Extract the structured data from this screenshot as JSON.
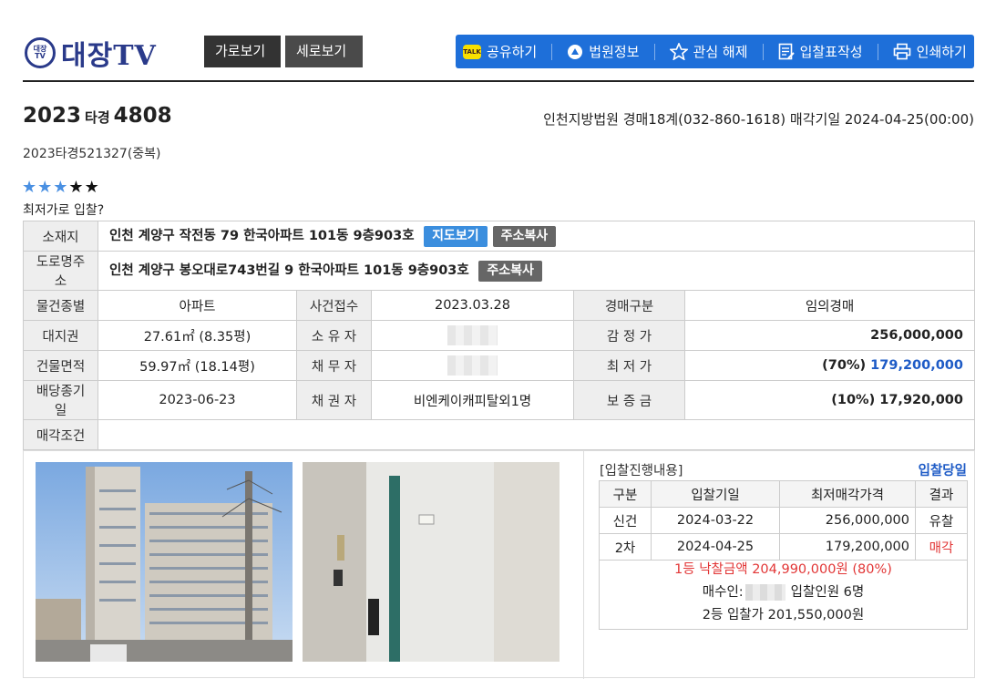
{
  "header": {
    "logo_mark": "대장 TV",
    "logo_text": "대장TV",
    "view_horizontal": "가로보기",
    "view_vertical": "세로보기",
    "tools": [
      {
        "label": "공유하기",
        "icon": "kakaotalk-icon"
      },
      {
        "label": "법원정보",
        "icon": "court-icon"
      },
      {
        "label": "관심 해제",
        "icon": "star-outline-icon"
      },
      {
        "label": "입찰표작성",
        "icon": "form-icon"
      },
      {
        "label": "인쇄하기",
        "icon": "printer-icon"
      }
    ],
    "talk_icon_text": "TALK"
  },
  "case": {
    "year": "2023",
    "type": "타경",
    "number": "4808",
    "court_info": "인천지방법원 경매18계(032-860-1618) 매각기일 2024-04-25(00:00)",
    "sub_case": "2023타경521327(중복)",
    "rating": 3,
    "rating_max": 5,
    "question": "최저가로 입찰?"
  },
  "info": {
    "location_label": "소재지",
    "location": "인천 계양구 작전동 79 한국아파트 101동 9층903호",
    "map_button": "지도보기",
    "copy_button": "주소복사",
    "road_label": "도로명주소",
    "road": "인천 계양구 봉오대로743번길 9 한국아파트 101동 9층903호",
    "rows": [
      {
        "l1": "물건종별",
        "v1": "아파트",
        "l2": "사건접수",
        "v2": "2023.03.28",
        "l3": "경매구분",
        "v3": "임의경매"
      },
      {
        "l1": "대지권",
        "v1": "27.61㎡ (8.35평)",
        "l2": "소 유 자",
        "v2": "",
        "l3": "감 정 가",
        "v3": "256,000,000"
      },
      {
        "l1": "건물면적",
        "v1": "59.97㎡ (18.14평)",
        "l2": "채 무 자",
        "v2": "",
        "l3": "최 저 가",
        "v3_pct": "(70%)",
        "v3": "179,200,000"
      },
      {
        "l1": "배당종기일",
        "v1": "2023-06-23",
        "l2": "채 권 자",
        "v2": "비엔케이캐피탈외1명",
        "l3": "보 증 금",
        "v3": "(10%) 17,920,000"
      }
    ],
    "condition_label": "매각조건",
    "condition": ""
  },
  "bids": {
    "title": "[입찰진행내용]",
    "today": "입찰당일",
    "headers": [
      "구분",
      "입찰기일",
      "최저매각가격",
      "결과"
    ],
    "rows": [
      {
        "round": "신건",
        "date": "2024-03-22",
        "price": "256,000,000",
        "result": "유찰"
      },
      {
        "round": "2차",
        "date": "2024-04-25",
        "price": "179,200,000",
        "result": "매각"
      }
    ],
    "winning": "1등 낙찰금액 204,990,000원 (80%)",
    "buyer_label": "매수인:",
    "bidders": "입찰인원 6명",
    "second": "2등 입찰가 201,550,000원"
  },
  "colors": {
    "accent": "#1e6fd9",
    "logo": "#2a3a8a",
    "highlight": "#1e5bc6",
    "sold": "#e23636"
  }
}
